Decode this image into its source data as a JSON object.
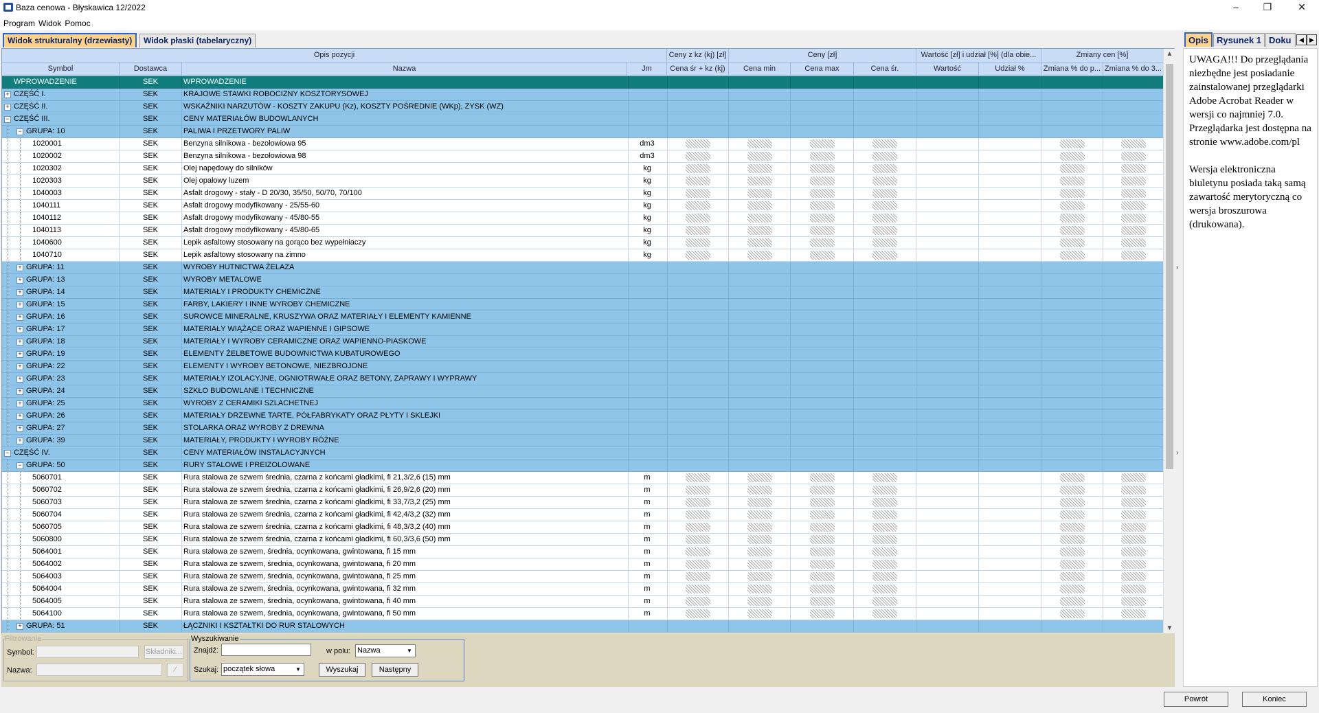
{
  "window": {
    "title": "Baza cenowa - Błyskawica 12/2022",
    "min": "–",
    "max": "❐",
    "close": "✕"
  },
  "menu": [
    "Program",
    "Widok",
    "Pomoc"
  ],
  "view_tabs": [
    "Widok strukturalny (drzewiasty)",
    "Widok płaski (tabelaryczny)"
  ],
  "header_bands": {
    "opis": "Opis pozycji",
    "ceny_kz": "Ceny z kz (kj) [zł]",
    "ceny": "Ceny [zł]",
    "wartosc": "Wartość [zł] i udział [%] (dla obie...",
    "zmiany": "Zmiany cen [%]"
  },
  "columns": {
    "symbol": "Symbol",
    "dostawca": "Dostawca",
    "nazwa": "Nazwa",
    "jm": "Jm",
    "cena_sr_kz": "Cena śr + kz (kj)",
    "cena_min": "Cena min",
    "cena_max": "Cena max",
    "cena_sr": "Cena śr.",
    "wartosc": "Wartość",
    "udzial": "Udział %",
    "zmiana1": "Zmiana % do p...",
    "zmiana2": "Zmiana % do 3..."
  },
  "rows": [
    {
      "level": 0,
      "type": "selected",
      "tog": "",
      "sym": "WPROWADZENIE",
      "dost": "SEK",
      "name": "WPROWADZENIE",
      "jm": "",
      "v": false
    },
    {
      "level": 0,
      "type": "group",
      "tog": "+",
      "sym": "CZĘŚĆ I.",
      "dost": "SEK",
      "name": "KRAJOWE STAWKI ROBOCIZNY KOSZTORYSOWEJ",
      "jm": "",
      "v": false
    },
    {
      "level": 0,
      "type": "group",
      "tog": "+",
      "sym": "CZĘŚĆ II.",
      "dost": "SEK",
      "name": "WSKAŹNIKI NARZUTÓW - KOSZTY ZAKUPU (Kz), KOSZTY POŚREDNIE (WKp), ZYSK (WZ)",
      "jm": "",
      "v": false
    },
    {
      "level": 0,
      "type": "group",
      "tog": "−",
      "sym": "CZĘŚĆ III.",
      "dost": "SEK",
      "name": "CENY MATERIAŁÓW BUDOWLANYCH",
      "jm": "",
      "v": false
    },
    {
      "level": 1,
      "type": "group",
      "tog": "−",
      "sym": "GRUPA: 10",
      "dost": "SEK",
      "name": "PALIWA I PRZETWORY PALIW",
      "jm": "",
      "v": false
    },
    {
      "level": 2,
      "type": "item",
      "tog": "",
      "sym": "1020001",
      "dost": "SEK",
      "name": "Benzyna silnikowa - bezołowiowa 95",
      "jm": "dm3",
      "v": true
    },
    {
      "level": 2,
      "type": "item",
      "tog": "",
      "sym": "1020002",
      "dost": "SEK",
      "name": "Benzyna silnikowa - bezołowiowa 98",
      "jm": "dm3",
      "v": true
    },
    {
      "level": 2,
      "type": "item",
      "tog": "",
      "sym": "1020302",
      "dost": "SEK",
      "name": "Olej napędowy do silników",
      "jm": "kg",
      "v": true
    },
    {
      "level": 2,
      "type": "item",
      "tog": "",
      "sym": "1020303",
      "dost": "SEK",
      "name": "Olej opałowy luzem",
      "jm": "kg",
      "v": true
    },
    {
      "level": 2,
      "type": "item",
      "tog": "",
      "sym": "1040003",
      "dost": "SEK",
      "name": "Asfalt drogowy - stały - D 20/30, 35/50, 50/70, 70/100",
      "jm": "kg",
      "v": true
    },
    {
      "level": 2,
      "type": "item",
      "tog": "",
      "sym": "1040111",
      "dost": "SEK",
      "name": "Asfalt drogowy modyfikowany - 25/55-60",
      "jm": "kg",
      "v": true
    },
    {
      "level": 2,
      "type": "item",
      "tog": "",
      "sym": "1040112",
      "dost": "SEK",
      "name": "Asfalt drogowy modyfikowany - 45/80-55",
      "jm": "kg",
      "v": true
    },
    {
      "level": 2,
      "type": "item",
      "tog": "",
      "sym": "1040113",
      "dost": "SEK",
      "name": "Asfalt drogowy modyfikowany - 45/80-65",
      "jm": "kg",
      "v": true
    },
    {
      "level": 2,
      "type": "item",
      "tog": "",
      "sym": "1040600",
      "dost": "SEK",
      "name": "Lepik asfaltowy stosowany na gorąco bez wypełniaczy",
      "jm": "kg",
      "v": true
    },
    {
      "level": 2,
      "type": "item",
      "tog": "",
      "sym": "1040710",
      "dost": "SEK",
      "name": "Lepik asfaltowy stosowany na zimno",
      "jm": "kg",
      "v": true
    },
    {
      "level": 1,
      "type": "group",
      "tog": "+",
      "sym": "GRUPA: 11",
      "dost": "SEK",
      "name": "WYROBY HUTNICTWA ŻELAZA",
      "jm": "",
      "v": false
    },
    {
      "level": 1,
      "type": "group",
      "tog": "+",
      "sym": "GRUPA: 13",
      "dost": "SEK",
      "name": "WYROBY METALOWE",
      "jm": "",
      "v": false
    },
    {
      "level": 1,
      "type": "group",
      "tog": "+",
      "sym": "GRUPA: 14",
      "dost": "SEK",
      "name": "MATERIAŁY I PRODUKTY CHEMICZNE",
      "jm": "",
      "v": false
    },
    {
      "level": 1,
      "type": "group",
      "tog": "+",
      "sym": "GRUPA: 15",
      "dost": "SEK",
      "name": "FARBY, LAKIERY I INNE WYROBY CHEMICZNE",
      "jm": "",
      "v": false
    },
    {
      "level": 1,
      "type": "group",
      "tog": "+",
      "sym": "GRUPA: 16",
      "dost": "SEK",
      "name": "SUROWCE MINERALNE, KRUSZYWA ORAZ MATERIAŁY I ELEMENTY KAMIENNE",
      "jm": "",
      "v": false
    },
    {
      "level": 1,
      "type": "group",
      "tog": "+",
      "sym": "GRUPA: 17",
      "dost": "SEK",
      "name": "MATERIAŁY WIĄŻĄCE ORAZ WAPIENNE I GIPSOWE",
      "jm": "",
      "v": false
    },
    {
      "level": 1,
      "type": "group",
      "tog": "+",
      "sym": "GRUPA: 18",
      "dost": "SEK",
      "name": "MATERIAŁY I WYROBY CERAMICZNE ORAZ WAPIENNO-PIASKOWE",
      "jm": "",
      "v": false
    },
    {
      "level": 1,
      "type": "group",
      "tog": "+",
      "sym": "GRUPA: 19",
      "dost": "SEK",
      "name": "ELEMENTY ŻELBETOWE BUDOWNICTWA KUBATUROWEGO",
      "jm": "",
      "v": false
    },
    {
      "level": 1,
      "type": "group",
      "tog": "+",
      "sym": "GRUPA: 22",
      "dost": "SEK",
      "name": "ELEMENTY I WYROBY BETONOWE, NIEZBROJONE",
      "jm": "",
      "v": false
    },
    {
      "level": 1,
      "type": "group",
      "tog": "+",
      "sym": "GRUPA: 23",
      "dost": "SEK",
      "name": "MATERIAŁY IZOLACYJNE, OGNIOTRWAŁE ORAZ BETONY, ZAPRAWY I WYPRAWY",
      "jm": "",
      "v": false
    },
    {
      "level": 1,
      "type": "group",
      "tog": "+",
      "sym": "GRUPA: 24",
      "dost": "SEK",
      "name": "SZKŁO BUDOWLANE I TECHNICZNE",
      "jm": "",
      "v": false
    },
    {
      "level": 1,
      "type": "group",
      "tog": "+",
      "sym": "GRUPA: 25",
      "dost": "SEK",
      "name": "WYROBY Z CERAMIKI SZLACHETNEJ",
      "jm": "",
      "v": false
    },
    {
      "level": 1,
      "type": "group",
      "tog": "+",
      "sym": "GRUPA: 26",
      "dost": "SEK",
      "name": "MATERIAŁY DRZEWNE TARTE, PÓŁFABRYKATY ORAZ PŁYTY I SKLEJKI",
      "jm": "",
      "v": false
    },
    {
      "level": 1,
      "type": "group",
      "tog": "+",
      "sym": "GRUPA: 27",
      "dost": "SEK",
      "name": "STOLARKA ORAZ WYROBY Z DREWNA",
      "jm": "",
      "v": false
    },
    {
      "level": 1,
      "type": "group",
      "tog": "+",
      "sym": "GRUPA: 39",
      "dost": "SEK",
      "name": "MATERIAŁY, PRODUKTY I WYROBY RÓŻNE",
      "jm": "",
      "v": false
    },
    {
      "level": 0,
      "type": "group",
      "tog": "−",
      "sym": "CZĘŚĆ IV.",
      "dost": "SEK",
      "name": "CENY MATERIAŁÓW INSTALACYJNYCH",
      "jm": "",
      "v": false
    },
    {
      "level": 1,
      "type": "group",
      "tog": "−",
      "sym": "GRUPA: 50",
      "dost": "SEK",
      "name": "RURY STALOWE I PREIZOLOWANE",
      "jm": "",
      "v": false
    },
    {
      "level": 2,
      "type": "item",
      "tog": "",
      "sym": "5060701",
      "dost": "SEK",
      "name": "Rura stalowa ze szwem średnia, czarna z końcami gładkimi, fi 21,3/2,6 (15) mm",
      "jm": "m",
      "v": true
    },
    {
      "level": 2,
      "type": "item",
      "tog": "",
      "sym": "5060702",
      "dost": "SEK",
      "name": "Rura stalowa ze szwem średnia, czarna z końcami gładkimi, fi 26,9/2,6 (20) mm",
      "jm": "m",
      "v": true
    },
    {
      "level": 2,
      "type": "item",
      "tog": "",
      "sym": "5060703",
      "dost": "SEK",
      "name": "Rura stalowa ze szwem średnia, czarna z końcami gładkimi, fi 33,7/3,2 (25) mm",
      "jm": "m",
      "v": true
    },
    {
      "level": 2,
      "type": "item",
      "tog": "",
      "sym": "5060704",
      "dost": "SEK",
      "name": "Rura stalowa ze szwem średnia, czarna z końcami gładkimi, fi 42,4/3,2 (32) mm",
      "jm": "m",
      "v": true
    },
    {
      "level": 2,
      "type": "item",
      "tog": "",
      "sym": "5060705",
      "dost": "SEK",
      "name": "Rura stalowa ze szwem średnia, czarna z końcami gładkimi, fi 48,3/3,2 (40) mm",
      "jm": "m",
      "v": true
    },
    {
      "level": 2,
      "type": "item",
      "tog": "",
      "sym": "5060800",
      "dost": "SEK",
      "name": "Rura stalowa ze szwem średnia, czarna z końcami gładkimi, fi 60,3/3,6 (50) mm",
      "jm": "m",
      "v": true
    },
    {
      "level": 2,
      "type": "item",
      "tog": "",
      "sym": "5064001",
      "dost": "SEK",
      "name": "Rura stalowa ze szwem, średnia, ocynkowana, gwintowana, fi 15 mm",
      "jm": "m",
      "v": true
    },
    {
      "level": 2,
      "type": "item",
      "tog": "",
      "sym": "5064002",
      "dost": "SEK",
      "name": "Rura stalowa ze szwem, średnia, ocynkowana, gwintowana, fi 20 mm",
      "jm": "m",
      "v": true
    },
    {
      "level": 2,
      "type": "item",
      "tog": "",
      "sym": "5064003",
      "dost": "SEK",
      "name": "Rura stalowa ze szwem, średnia, ocynkowana, gwintowana, fi 25 mm",
      "jm": "m",
      "v": true
    },
    {
      "level": 2,
      "type": "item",
      "tog": "",
      "sym": "5064004",
      "dost": "SEK",
      "name": "Rura stalowa ze szwem, średnia, ocynkowana, gwintowana, fi 32 mm",
      "jm": "m",
      "v": true
    },
    {
      "level": 2,
      "type": "item",
      "tog": "",
      "sym": "5064005",
      "dost": "SEK",
      "name": "Rura stalowa ze szwem, średnia, ocynkowana, gwintowana, fi 40 mm",
      "jm": "m",
      "v": true
    },
    {
      "level": 2,
      "type": "item",
      "tog": "",
      "sym": "5064100",
      "dost": "SEK",
      "name": "Rura stalowa ze szwem, średnia, ocynkowana, gwintowana, fi 50 mm",
      "jm": "m",
      "v": true
    },
    {
      "level": 1,
      "type": "group",
      "tog": "+",
      "sym": "GRUPA: 51",
      "dost": "SEK",
      "name": "ŁĄCZNIKI I KSZTAŁTKI DO RUR STALOWYCH",
      "jm": "",
      "v": false
    }
  ],
  "right_tabs": [
    "Opis",
    "Rysunek 1",
    "Doku"
  ],
  "description": "UWAGA!!! Do przeglądania niezbędne jest posiadanie zainstalowanej przeglądarki Adobe Acrobat Reader w wersji co najmniej 7.0. Przeglądarka jest dostępna na stronie www.adobe.com/pl\n\nWersja elektroniczna biuletynu posiada taką samą zawartość merytoryczną co wersja broszurowa (drukowana).",
  "filter": {
    "legend": "Filtrowanie",
    "symbol_label": "Symbol:",
    "nazwa_label": "Nazwa:",
    "skladniki": "Składniki...",
    "clear": "⁄"
  },
  "search": {
    "legend": "Wyszukiwanie",
    "znajdz_label": "Znajdź:",
    "znajdz_value": "",
    "wpolu_label": "w polu:",
    "wpolu_value": "Nazwa",
    "szukaj_label": "Szukaj:",
    "szukaj_value": "początek słowa",
    "search_btn": "Wyszukaj",
    "next_btn": "Następny"
  },
  "footer": {
    "back": "Powrót",
    "end": "Koniec"
  }
}
